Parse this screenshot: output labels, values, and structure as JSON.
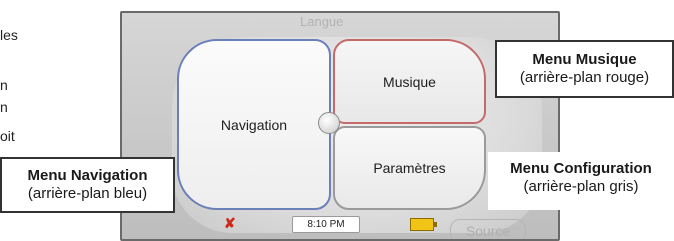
{
  "left_text": [
    "les",
    "n",
    "n",
    "oit"
  ],
  "device": {
    "ghost_top": "Langue",
    "ghost_source": "Source",
    "panels": {
      "navigation": "Navigation",
      "musique": "Musique",
      "parametres": "Paramètres"
    },
    "status": {
      "time": "8:10 PM"
    }
  },
  "callouts": {
    "musique": {
      "title": "Menu Musique",
      "subtitle": "(arrière-plan rouge)"
    },
    "navigation": {
      "title": "Menu Navigation",
      "subtitle": "(arrière-plan bleu)"
    },
    "configuration": {
      "title": "Menu Configuration",
      "subtitle": "(arrière-plan gris)"
    }
  },
  "colors": {
    "nav_border": "#6b7fb8",
    "music_border": "#c46a6a",
    "param_border": "#9a9a9a"
  }
}
